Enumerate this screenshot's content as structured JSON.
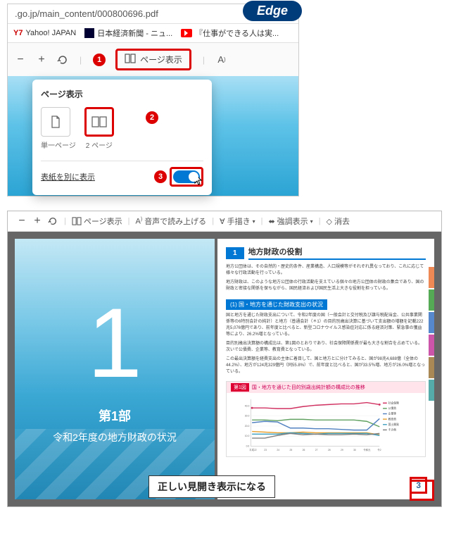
{
  "browser_label": "Edge",
  "url": ".go.jp/main_content/000800696.pdf",
  "bookmarks": {
    "yahoo": "Yahoo! JAPAN",
    "nikkei": "日本経済新聞 - ニュ...",
    "youtube": "『仕事ができる人は実..."
  },
  "toolbar": {
    "page_view_label": "ページ表示",
    "read_aloud_label": "音声で読み上げる",
    "draw_label": "手描き",
    "highlight_label": "強調表示",
    "erase_label": "消去"
  },
  "callouts": {
    "one": "1",
    "two": "2",
    "three": "3"
  },
  "popup": {
    "title": "ページ表示",
    "single_label": "単一ページ",
    "two_label": "2 ページ",
    "cover_label": "表紙を別に表示"
  },
  "document": {
    "left_page_number": "1",
    "left_page_heading": "第1部",
    "left_page_subtitle": "令和2年度の地方財政の状況",
    "section1_num": "1",
    "section1_title": "地方財政の役割",
    "body1": "地方公団体は、その自然的・歴史的条件、産業構造、人口規模等がそれぞれ異なっており、これに応じて様々な行政活動を行っている。",
    "body2": "地方財政は、このような地方公団体の行政活動を支えている個々の地方公団体の財政の集合であり、国の財政と密接な関係を保ちながら、国民経済および国民生活上大きな役割を担っている。",
    "subsection1": "(1) 国・地方を通じた財政支出の状況",
    "body3": "国と地方を通じた財政支出について、令和2年度の国（一般会計と交付税及び譲与税配当金、公共事業関係等の6特別会計の純計）と地方（普通会計（＊1）の目的別歳出決算に基づいて支出額の増額を記載222兆5,076億円であり、前年度と比べると、新型コロナウイルス感染症対応に係る経済対策、緊急事の獲益等により、26.2%増となっている。",
    "body4": "目的別歳出決算額の構成比は、第1図のとおりであり、社会保障関係費が最も大きな割合を占めている。次いで公債費、企業等、教育費となっている。",
    "body5": "この最出決算額を経費支出の主体に着目して、国と地方とに分けてみると、国が98兆4,688億（全体の44.2%）、地方が124兆329億円（同55.8%）で、前年度と比べると、国が33.5％増、地方が26.0%増となっている。",
    "chart_badge": "第1図",
    "chart_title": "国・地方を通じた目的別歳出純計額の構成比の推移",
    "page_right_number": "3"
  },
  "caption": "正しい見開き表示になる",
  "chart_data": {
    "type": "line",
    "title": "国・地方を通じた目的別歳出純計額の構成比の推移",
    "xlabel": "年度",
    "ylabel": "%",
    "ylim": [
      0,
      40
    ],
    "categories": [
      "平成22",
      "23",
      "24",
      "25",
      "26",
      "27",
      "28",
      "29",
      "30",
      "令和元",
      "令和2"
    ],
    "legend_position": "right",
    "series": [
      {
        "name": "社会保障関係費",
        "color": "#d03060",
        "values": [
          30.7,
          30.6,
          30.4,
          30.5,
          31.9,
          32.8,
          33.2,
          33.7,
          33.9,
          34.7,
          33.6
        ]
      },
      {
        "name": "公債費",
        "color": "#60a060",
        "values": [
          21.2,
          21.1,
          20.4,
          21.4,
          21.6,
          21.2,
          21.1,
          21.0,
          21.0,
          20.1,
          16.2
        ]
      },
      {
        "name": "企業等",
        "color": "#5080c0",
        "values": [
          18.9,
          19.8,
          19.3,
          15.0,
          15.0,
          14.7,
          14.5,
          14.1,
          13.3,
          13.4,
          22.0
        ]
      },
      {
        "name": "教育費",
        "color": "#e8a030",
        "values": [
          12.3,
          11.9,
          11.4,
          11.1,
          11.5,
          11.3,
          11.1,
          11.1,
          11.1,
          11.3,
          9.0
        ]
      },
      {
        "name": "国土開発費",
        "color": "#40a0c0",
        "values": [
          10.0,
          9.8,
          9.7,
          11.5,
          10.6,
          10.0,
          10.3,
          10.5,
          10.4,
          10.7,
          8.6
        ]
      },
      {
        "name": "その他",
        "color": "#808080",
        "values": [
          6.9,
          6.8,
          8.8,
          10.5,
          9.4,
          10.0,
          9.8,
          9.6,
          10.3,
          9.8,
          10.6
        ]
      }
    ]
  }
}
